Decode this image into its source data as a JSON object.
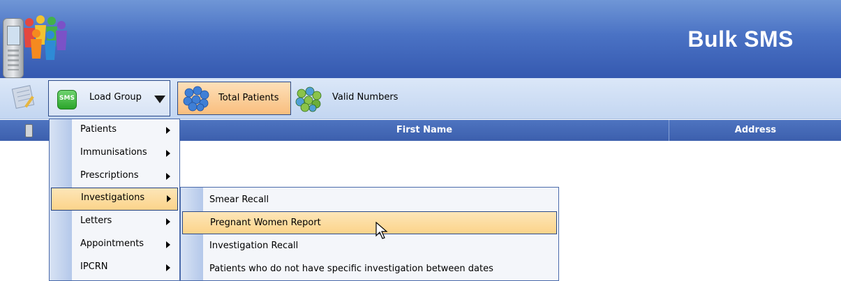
{
  "header": {
    "title": "Bulk SMS",
    "logo_icon": "people-group-icon",
    "phone_icon": "mobile-phone-icon",
    "color": "#3f65b8"
  },
  "toolbar": {
    "notes_icon": "notepad-icon",
    "load_group": {
      "label": "Load Group",
      "icon": "sms-icon",
      "icon_text": "SMS"
    },
    "total_patients": {
      "label": "Total Patients",
      "icon": "blue-bubbles-icon"
    },
    "valid_numbers": {
      "label": "Valid Numbers",
      "icon": "green-bubbles-icon"
    }
  },
  "grid": {
    "columns": [
      {
        "label": "",
        "icon": "mobile-phone-icon"
      },
      {
        "label": "First Name"
      },
      {
        "label": "Address"
      }
    ]
  },
  "menu": {
    "items": [
      {
        "label": "Patients"
      },
      {
        "label": "Immunisations"
      },
      {
        "label": "Prescriptions"
      },
      {
        "label": "Investigations"
      },
      {
        "label": "Letters"
      },
      {
        "label": "Appointments"
      },
      {
        "label": "IPCRN"
      }
    ],
    "highlighted": "Investigations"
  },
  "submenu": {
    "items": [
      {
        "label": "Smear Recall"
      },
      {
        "label": "Pregnant Women Report"
      },
      {
        "label": "Investigation Recall"
      },
      {
        "label": "Patients who do not have specific investigation between dates"
      }
    ],
    "highlighted": "Pregnant Women Report"
  }
}
